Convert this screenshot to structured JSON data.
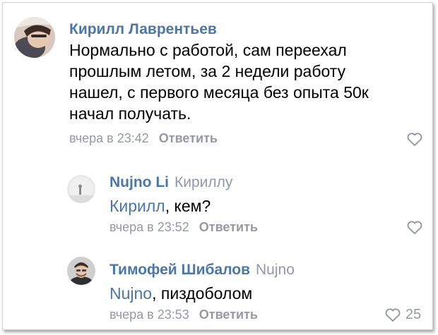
{
  "comments": [
    {
      "author": "Кирилл Лаврентьев",
      "reply_to": "",
      "text": "Нормально с работой, сам переехал прошлым летом, за 2 недели работу нашел, с первого месяца без опыта 50к начал получать.",
      "mention": "",
      "time": "вчера в 23:42",
      "reply_label": "Ответить",
      "likes": ""
    },
    {
      "author": "Nujno Li",
      "reply_to": "Кириллу",
      "mention": "Кирилл",
      "text": ", кем?",
      "time": "вчера в 23:52",
      "reply_label": "Ответить",
      "likes": ""
    },
    {
      "author": "Тимофей Шибалов",
      "reply_to": "Nujno",
      "mention": "Nujno",
      "text": ", пиздоболом",
      "time": "вчера в 23:53",
      "reply_label": "Ответить",
      "likes": "25"
    }
  ],
  "icons": {
    "like": "heart-outline-icon",
    "avatar": "user-avatar"
  },
  "colors": {
    "link": "#4a76a8",
    "meta": "#939aa3",
    "text": "#000000"
  }
}
